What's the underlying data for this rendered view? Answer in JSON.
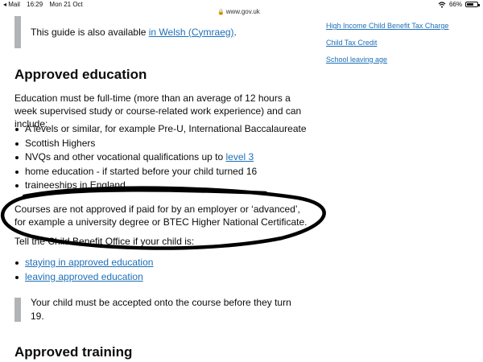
{
  "status_bar": {
    "back_app": "◂ Mail",
    "time": "16:29",
    "date": "Mon 21 Oct",
    "url": "www.gov.uk",
    "battery": "66%",
    "battery_level": 0.66
  },
  "top_inset": {
    "text": "This guide is also available ",
    "link": "in Welsh (Cymraeg)",
    "trail": "."
  },
  "related_links": [
    "High Income Child Benefit Tax Charge",
    "Child Tax Credit",
    "School leaving age"
  ],
  "section_education": {
    "heading": "Approved education",
    "intro": "Education must be full-time (more than an average of 12 hours a week supervised study or course-related work experience) and can include:",
    "bullets": [
      "A levels or similar, for example Pre-U, International Baccalaureate",
      "Scottish Highers",
      "NVQs and other vocational qualifications up to ",
      "home education - if started before your child turned 16",
      "traineeships in England"
    ],
    "bullet_link": "level 3",
    "not_approved": "Courses are not approved if paid for by an employer or ‘advanced’, for example a university degree or BTEC Higher National Certificate.",
    "tell_office": "Tell the Child Benefit Office if your child is:",
    "tell_links": [
      "staying in approved education",
      "leaving approved education"
    ],
    "age_note": "Your child must be accepted onto the course before they turn 19."
  },
  "section_training": {
    "heading": "Approved training"
  }
}
